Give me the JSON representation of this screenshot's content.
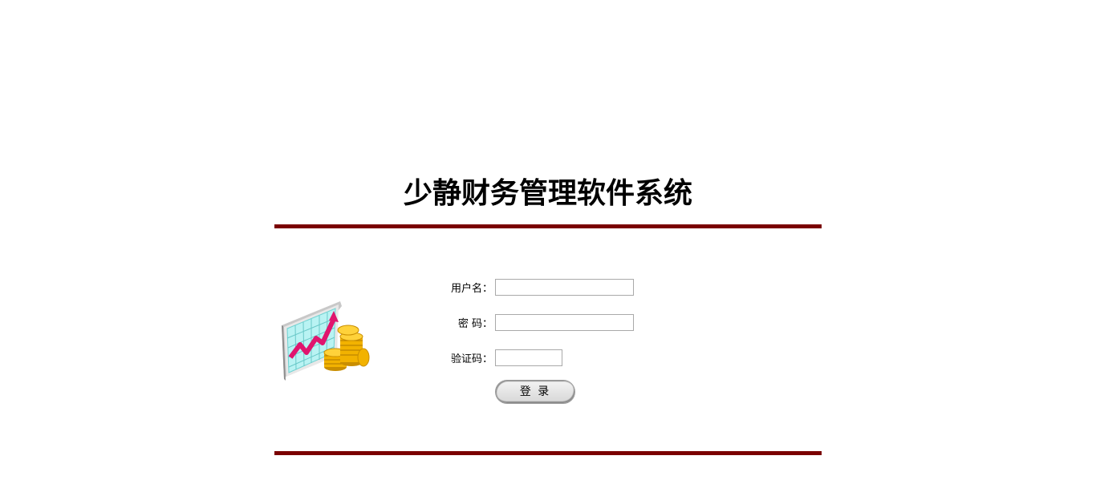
{
  "header": {
    "title": "少静财务管理软件系统"
  },
  "colors": {
    "rule": "#7a0000",
    "title": "#000000",
    "chart_line": "#e0156e",
    "chart_grid": "#69d7d7",
    "coin": "#f2b200"
  },
  "illustration": {
    "icon": "finance-chart-coins-icon"
  },
  "login_form": {
    "username_label": "用户名：",
    "password_label": "密 码：",
    "captcha_label": "验证码：",
    "username_value": "",
    "password_value": "",
    "captcha_value": "",
    "login_button": "登 录"
  }
}
